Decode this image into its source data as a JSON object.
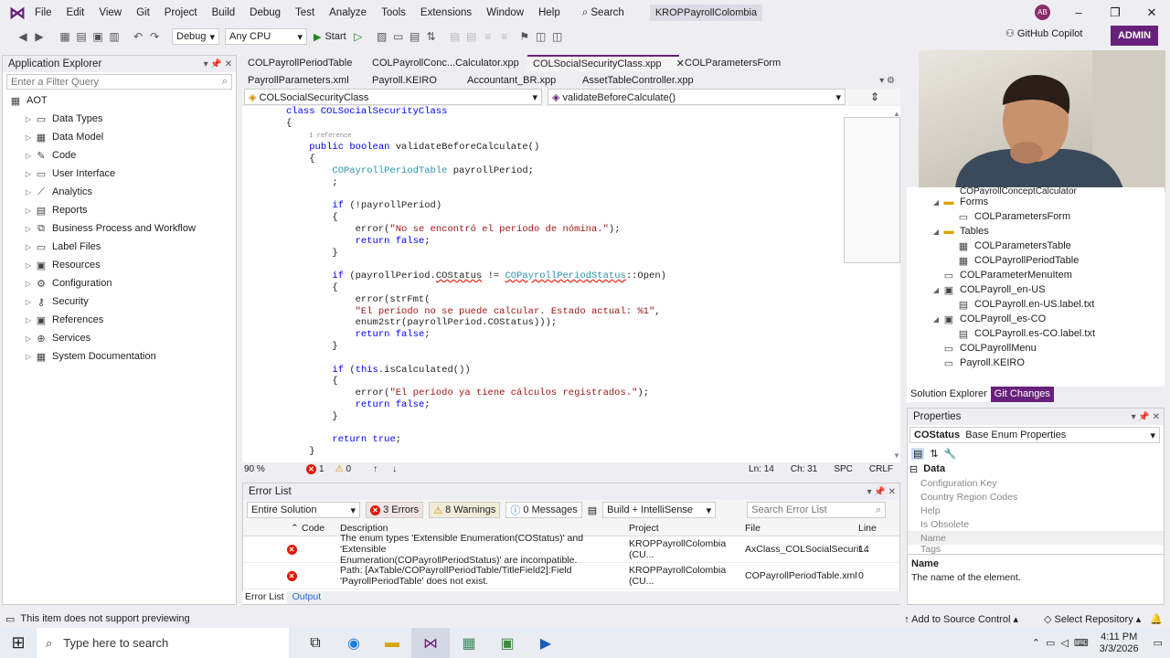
{
  "menu": [
    "File",
    "Edit",
    "View",
    "Git",
    "Project",
    "Build",
    "Debug",
    "Test",
    "Analyze",
    "Tools",
    "Extensions",
    "Window",
    "Help"
  ],
  "search_label": "Search",
  "solution_name": "KROPPayrollColombia",
  "avatar_initials": "AB",
  "toolbar": {
    "config": "Debug",
    "platform": "Any CPU",
    "start": "Start",
    "copilot": "GitHub Copilot",
    "admin": "ADMIN"
  },
  "app_explorer": {
    "title": "Application Explorer",
    "filter_placeholder": "Enter a Filter Query",
    "root": "AOT",
    "items": [
      "Data Types",
      "Data Model",
      "Code",
      "User Interface",
      "Analytics",
      "Reports",
      "Business Process and Workflow",
      "Label Files",
      "Resources",
      "Configuration",
      "Security",
      "References",
      "Services",
      "System Documentation"
    ]
  },
  "tabs_row1": [
    "COLPayrollPeriodTable",
    "COLPayrollConc...Calculator.xpp",
    "COLSocialSecurityClass.xpp",
    "COLParametersForm"
  ],
  "tabs_row2": [
    "PayrollParameters.xml",
    "Payroll.KEIRO",
    "Accountant_BR.xpp",
    "AssetTableController.xpp"
  ],
  "nav": {
    "class_dropdown": "COLSocialSecurityClass",
    "method_dropdown": "validateBeforeCalculate()"
  },
  "code": {
    "l1": "class COLSocialSecurityClass",
    "l2": "{",
    "ref": "1 reference",
    "l3_kw1": "public",
    "l3_kw2": "boolean",
    "l3_rest": " validateBeforeCalculate()",
    "l4": "{",
    "l5_type": "COPayrollPeriodTable",
    "l5_rest": " payrollPeriod;",
    "l6": ";",
    "l7_kw": "if",
    "l7_rest": " (!payrollPeriod)",
    "l8": "{",
    "l9_a": "error(",
    "l9_str": "\"No se encontró el período de nómina.\"",
    "l9_b": ");",
    "l10_kw": "return",
    "l10_kw2": "false",
    "l10_b": ";",
    "l11": "}",
    "l12_kw": "if",
    "l12_a": " (payrollPeriod.",
    "l12_err": "COStatus",
    "l12_b": " != ",
    "l12_type": "COPayrollPeriodStatus",
    "l12_c": "::Open)",
    "l13": "{",
    "l14": "error(strFmt(",
    "l15_str": "\"El período no se puede calcular. Estado actual: %1\"",
    "l15_b": ",",
    "l16_a": "enum2str(payrollPeriod.",
    "l16_err": "COStatus",
    "l16_b": ")));",
    "l17_kw": "return",
    "l17_kw2": "false",
    "l17_b": ";",
    "l18": "}",
    "l19_kw": "if",
    "l19_a": " (",
    "l19_kw2": "this",
    "l19_b": ".isCalculated())",
    "l20": "{",
    "l21_a": "error(",
    "l21_str": "\"El período ya tiene cálculos registrados.\"",
    "l21_b": ");",
    "l22_kw": "return",
    "l22_kw2": "false",
    "l22_b": ";",
    "l23": "}",
    "l24_kw": "return",
    "l24_kw2": "true",
    "l24_b": ";",
    "l25": "}"
  },
  "editor_status": {
    "zoom": "90 %",
    "errors": "1",
    "warnings": "0",
    "line": "Ln: 14",
    "col": "Ch: 31",
    "spc": "SPC",
    "crlf": "CRLF"
  },
  "error_list": {
    "title": "Error List",
    "scope": "Entire Solution",
    "errors": "3 Errors",
    "warnings": "8 Warnings",
    "messages": "0 Messages",
    "build_filter": "Build + IntelliSense",
    "search_placeholder": "Search Error List",
    "columns": [
      "Code",
      "Description",
      "Project",
      "File",
      "Line"
    ],
    "rows": [
      {
        "desc1": "The enum types 'Extensible Enumeration(COStatus)' and 'Extensible",
        "desc2": "Enumeration(COPayrollPeriodStatus)' are incompatible.",
        "project": "KROPPayrollColombia (CU...",
        "file": "AxClass_COLSocialSecurit...",
        "line": "14"
      },
      {
        "desc1": "Path: [AxTable/COPayrollPeriodTable/TitleField2]:Field",
        "desc2": "'PayrollPeriodTable' does not exist.",
        "project": "KROPPayrollColombia (CU...",
        "file": "COPayrollPeriodTable.xml",
        "line": "0"
      }
    ],
    "tab_errorlist": "Error List",
    "tab_output": "Output"
  },
  "solution_explorer": {
    "items": [
      {
        "label": "COPayrollConceptCalculator",
        "ico": "file"
      },
      {
        "label": "Forms",
        "ico": "folder"
      },
      {
        "label": "COLParametersForm",
        "ico": "form"
      },
      {
        "label": "Tables",
        "ico": "folder"
      },
      {
        "label": "COLParametersTable",
        "ico": "table"
      },
      {
        "label": "COLPayrollPeriodTable",
        "ico": "table"
      },
      {
        "label": "COLParameterMenuItem",
        "ico": "menu"
      },
      {
        "label": "COLPayroll_en-US",
        "ico": "label"
      },
      {
        "label": "COLPayroll.en-US.label.txt",
        "ico": "file"
      },
      {
        "label": "COLPayroll_es-CO",
        "ico": "label"
      },
      {
        "label": "COLPayroll.es-CO.label.txt",
        "ico": "file"
      },
      {
        "label": "COLPayrollMenu",
        "ico": "menu"
      },
      {
        "label": "Payroll.KEIRO",
        "ico": "menu"
      }
    ],
    "tab1": "Solution Explorer",
    "tab2": "Git Changes"
  },
  "properties": {
    "title": "Properties",
    "object": "COStatus",
    "object_type": "Base Enum Properties",
    "section": "Data",
    "rows": [
      "Configuration Key",
      "Country Region Codes",
      "Help",
      "Is Obsolete",
      "Name",
      "Tags"
    ],
    "desc_title": "Name",
    "desc_text": "The name of the element."
  },
  "statusbar": {
    "left": "This item does not support previewing",
    "source": "Add to Source Control",
    "repo": "Select Repository"
  },
  "taskbar": {
    "search": "Type here to search",
    "time": "4:11 PM",
    "date": "3/3/2026"
  }
}
